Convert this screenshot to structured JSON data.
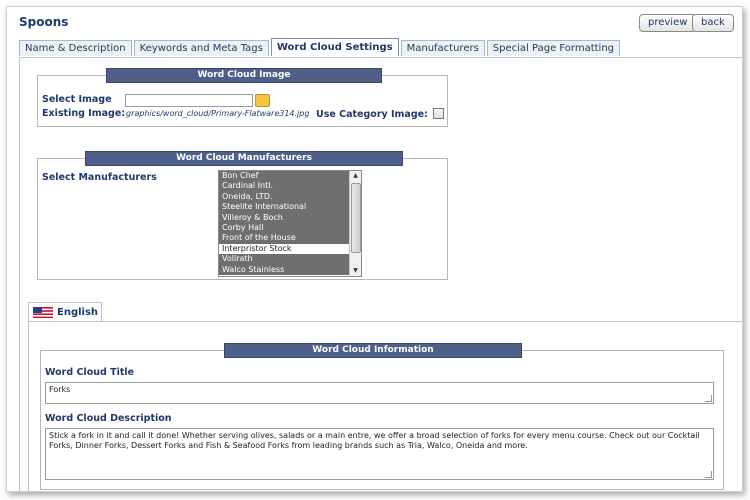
{
  "page": {
    "title": "Spoons"
  },
  "actions": {
    "preview": "preview",
    "back": "back"
  },
  "tabs": [
    {
      "label": "Name & Description"
    },
    {
      "label": "Keywords and Meta Tags"
    },
    {
      "label": "Word Cloud Settings",
      "active": true
    },
    {
      "label": "Manufacturers"
    },
    {
      "label": "Special Page Formatting"
    }
  ],
  "image_section": {
    "header": "Word Cloud Image",
    "select_label": "Select Image",
    "select_value": "",
    "existing_label": "Existing Image:",
    "existing_path": "graphics/word_cloud/Primary-Flatware314.jpg",
    "category_label": "Use Category Image:"
  },
  "manufacturer_section": {
    "header": "Word Cloud Manufacturers",
    "select_label": "Select Manufacturers",
    "items": [
      {
        "label": "Bon Chef",
        "selected": true
      },
      {
        "label": "Cardinal Intl.",
        "selected": true
      },
      {
        "label": "Oneida, LTD.",
        "selected": true
      },
      {
        "label": "Steelite International",
        "selected": true
      },
      {
        "label": "Villeroy & Boch",
        "selected": true
      },
      {
        "label": "Corby Hall",
        "selected": true
      },
      {
        "label": "Front of the House",
        "selected": true
      },
      {
        "label": "Interpristor Stock",
        "selected": false
      },
      {
        "label": "Vollrath",
        "selected": true
      },
      {
        "label": "Walco Stainless",
        "selected": true
      }
    ]
  },
  "language": {
    "tab_label": "English"
  },
  "info_section": {
    "header": "Word Cloud Information",
    "title_label": "Word Cloud Title",
    "title_value": "Forks",
    "description_label": "Word Cloud Description",
    "description_value": "Stick a fork in it and call it done! Whether serving olives, salads or a main entre, we offer a broad selection of forks for every menu course. Check out our Cocktail Forks, Dinner Forks, Dessert Forks and Fish & Seafood Forks from leading brands such as Tria, Walco, Oneida and more."
  },
  "colors": {
    "header_bar": "#4f5f8a",
    "selected_item": "#6f6f6f",
    "label_text": "#1f3a6a"
  }
}
